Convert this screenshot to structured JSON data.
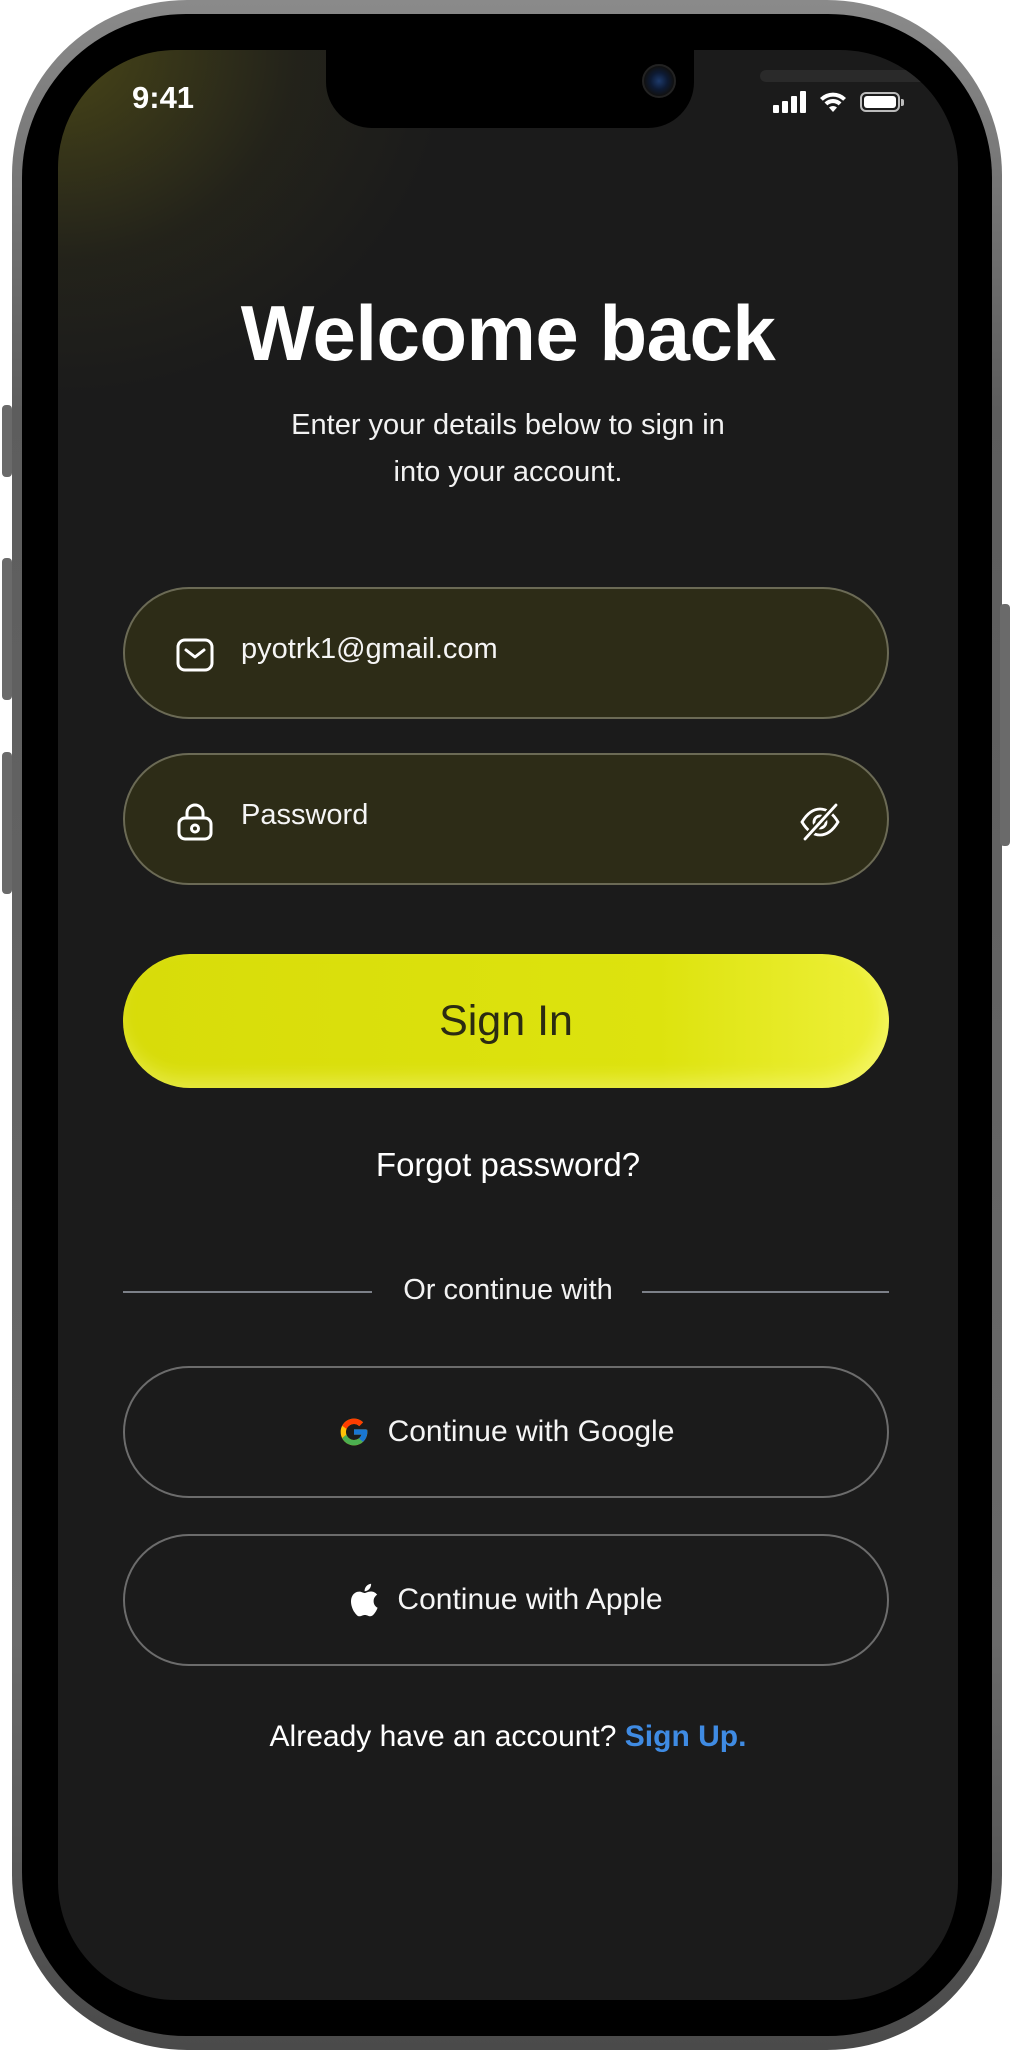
{
  "status_bar": {
    "time": "9:41"
  },
  "header": {
    "title": "Welcome back",
    "subtitle_line1": "Enter your details below to sign in",
    "subtitle_line2": "into your account."
  },
  "form": {
    "email_value": "pyotrk1@gmail.com",
    "password_placeholder": "Password",
    "sign_in_label": "Sign In",
    "forgot_label": "Forgot password?"
  },
  "divider": {
    "label": "Or continue with"
  },
  "social": {
    "google_label": "Continue with Google",
    "apple_label": "Continue with Apple"
  },
  "footer": {
    "prompt": "Already have an account?",
    "link": "Sign Up."
  },
  "colors": {
    "accent": "#dde30e",
    "field_bg": "#2d2c17",
    "screen_bg": "#1b1b1b",
    "link": "#3f8be3"
  },
  "icons": [
    "mail-icon",
    "lock-icon",
    "eye-off-icon",
    "google-icon",
    "apple-icon",
    "signal-icon",
    "wifi-icon",
    "battery-icon"
  ]
}
